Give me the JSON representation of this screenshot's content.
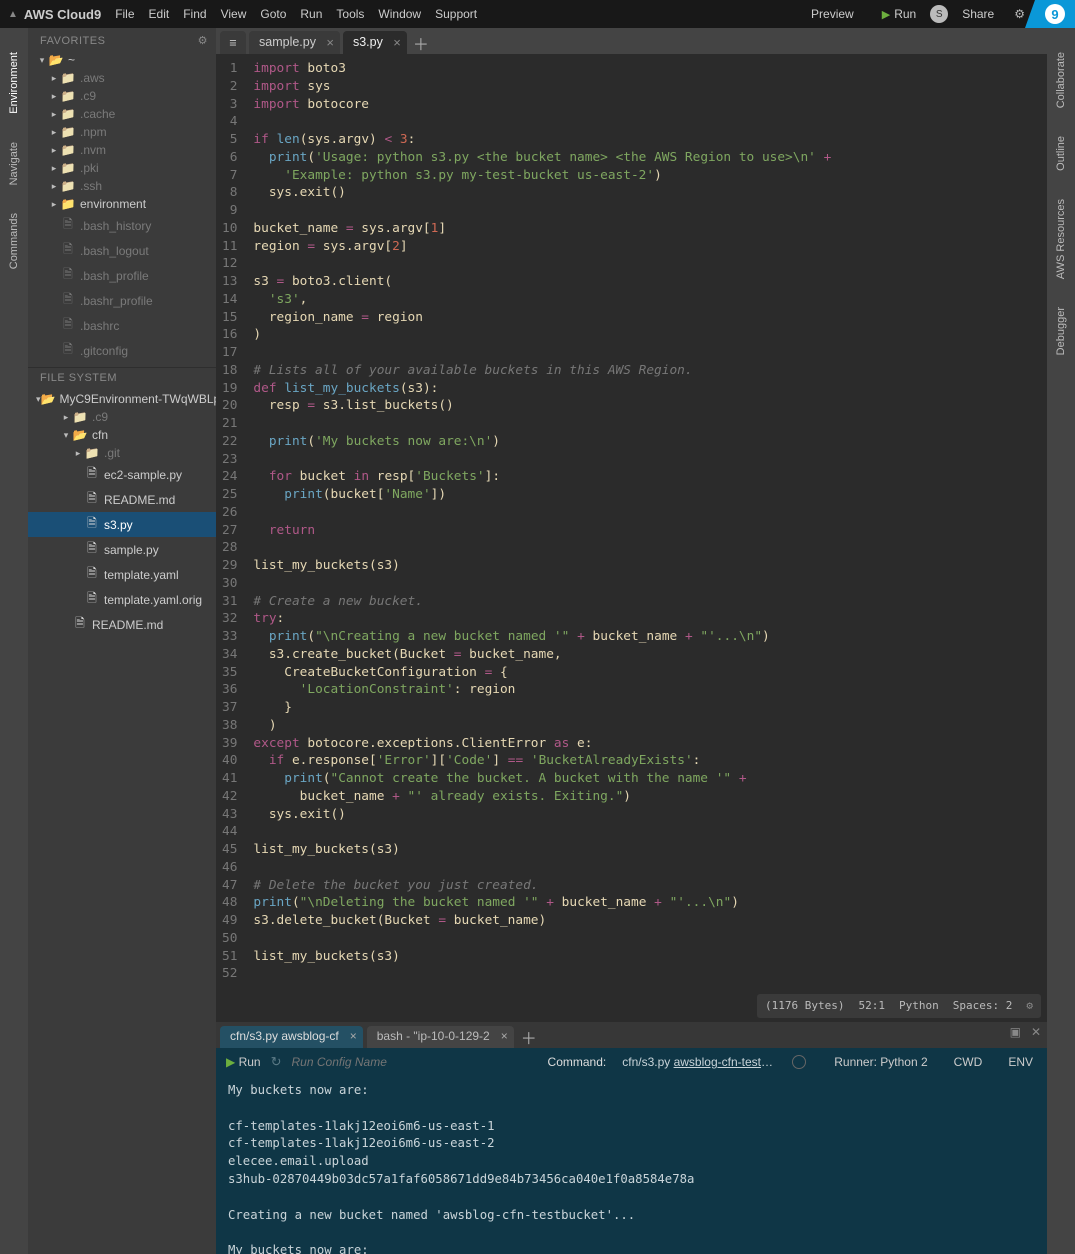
{
  "menubar": {
    "brand": "AWS Cloud9",
    "items": [
      "File",
      "Edit",
      "Find",
      "View",
      "Goto",
      "Run",
      "Tools",
      "Window",
      "Support"
    ],
    "preview": "Preview",
    "run": "Run",
    "share": "Share",
    "avatar_initial": "S"
  },
  "left_rail": [
    "Environment",
    "Navigate",
    "Commands"
  ],
  "right_rail": [
    "Collaborate",
    "Outline",
    "AWS Resources",
    "Debugger"
  ],
  "sidebar": {
    "favorites_label": "FAVORITES",
    "filesystem_label": "FILE SYSTEM",
    "home_label": "~",
    "home_children": [
      {
        "name": ".aws",
        "type": "folder",
        "hidden": true
      },
      {
        "name": ".c9",
        "type": "folder-special",
        "hidden": true
      },
      {
        "name": ".cache",
        "type": "folder",
        "hidden": true
      },
      {
        "name": ".npm",
        "type": "folder",
        "hidden": true
      },
      {
        "name": ".nvm",
        "type": "folder",
        "hidden": true
      },
      {
        "name": ".pki",
        "type": "folder",
        "hidden": true
      },
      {
        "name": ".ssh",
        "type": "folder",
        "hidden": true
      },
      {
        "name": "environment",
        "type": "folder",
        "hidden": false
      },
      {
        "name": ".bash_history",
        "type": "file",
        "hidden": true
      },
      {
        "name": ".bash_logout",
        "type": "file",
        "hidden": true
      },
      {
        "name": ".bash_profile",
        "type": "file",
        "hidden": true
      },
      {
        "name": ".bashr_profile",
        "type": "file",
        "hidden": true
      },
      {
        "name": ".bashrc",
        "type": "file",
        "hidden": true
      },
      {
        "name": ".gitconfig",
        "type": "file",
        "hidden": true
      }
    ],
    "env_root": "MyC9Environment-TWqWBLp",
    "env_children": [
      {
        "name": ".c9",
        "type": "folder",
        "hidden": true,
        "depth": 1
      },
      {
        "name": "cfn",
        "type": "folder",
        "hidden": false,
        "open": true,
        "depth": 1
      },
      {
        "name": ".git",
        "type": "folder-special",
        "hidden": true,
        "depth": 2
      },
      {
        "name": "ec2-sample.py",
        "type": "file",
        "depth": 2
      },
      {
        "name": "README.md",
        "type": "file",
        "depth": 2
      },
      {
        "name": "s3.py",
        "type": "file",
        "depth": 2,
        "selected": true
      },
      {
        "name": "sample.py",
        "type": "file",
        "depth": 2
      },
      {
        "name": "template.yaml",
        "type": "file",
        "depth": 2
      },
      {
        "name": "template.yaml.orig",
        "type": "file",
        "depth": 2
      },
      {
        "name": "README.md",
        "type": "file",
        "depth": 1
      }
    ]
  },
  "tabs": [
    {
      "label": "sample.py",
      "active": false
    },
    {
      "label": "s3.py",
      "active": true
    }
  ],
  "editor_status": {
    "bytes": "(1176 Bytes)",
    "pos": "52:1",
    "lang": "Python",
    "spaces": "Spaces: 2"
  },
  "code_lines": [
    "<span class='kw'>import</span> <span class='id'>boto3</span>",
    "<span class='kw'>import</span> <span class='id'>sys</span>",
    "<span class='kw'>import</span> <span class='id'>botocore</span>",
    "",
    "<span class='kw'>if</span> <span class='fn'>len</span>(sys.argv) <span class='op'>&lt;</span> <span class='num'>3</span>:",
    "  <span class='fn'>print</span>(<span class='str'>'Usage: python s3.py &lt;the bucket name&gt; &lt;the AWS Region to use&gt;\\n'</span> <span class='op'>+</span>",
    "    <span class='str'>'Example: python s3.py my-test-bucket us-east-2'</span>)",
    "  sys.exit()",
    "",
    "bucket_name <span class='op'>=</span> sys.argv[<span class='num'>1</span>]",
    "region <span class='op'>=</span> sys.argv[<span class='num'>2</span>]",
    "",
    "s3 <span class='op'>=</span> boto3.client(",
    "  <span class='str'>'s3'</span>,",
    "  region_name <span class='op'>=</span> region",
    ")",
    "",
    "<span class='com'># Lists all of your available buckets in this AWS Region.</span>",
    "<span class='kw'>def</span> <span class='fn'>list_my_buckets</span>(s3):",
    "  resp <span class='op'>=</span> s3.list_buckets()",
    "",
    "  <span class='fn'>print</span>(<span class='str'>'My buckets now are:\\n'</span>)",
    "",
    "  <span class='kw'>for</span> bucket <span class='kw'>in</span> resp[<span class='str'>'Buckets'</span>]:",
    "    <span class='fn'>print</span>(bucket[<span class='str'>'Name'</span>])",
    "",
    "  <span class='kw'>return</span>",
    "",
    "list_my_buckets(s3)",
    "",
    "<span class='com'># Create a new bucket.</span>",
    "<span class='kw'>try</span>:",
    "  <span class='fn'>print</span>(<span class='str'>\"\\nCreating a new bucket named '\"</span> <span class='op'>+</span> bucket_name <span class='op'>+</span> <span class='str'>\"'...\\n\"</span>)",
    "  s3.create_bucket(Bucket <span class='op'>=</span> bucket_name,",
    "    CreateBucketConfiguration <span class='op'>=</span> {",
    "      <span class='str'>'LocationConstraint'</span>: region",
    "    }",
    "  )",
    "<span class='kw'>except</span> botocore.exceptions.ClientError <span class='kw'>as</span> e:",
    "  <span class='kw'>if</span> e.response[<span class='str'>'Error'</span>][<span class='str'>'Code'</span>] <span class='op'>==</span> <span class='str'>'BucketAlreadyExists'</span>:",
    "    <span class='fn'>print</span>(<span class='str'>\"Cannot create the bucket. A bucket with the name '\"</span> <span class='op'>+</span>",
    "      bucket_name <span class='op'>+</span> <span class='str'>\"' already exists. Exiting.\"</span>)",
    "  sys.exit()",
    "",
    "list_my_buckets(s3)",
    "",
    "<span class='com'># Delete the bucket you just created.</span>",
    "<span class='fn'>print</span>(<span class='str'>\"\\nDeleting the bucket named '\"</span> <span class='op'>+</span> bucket_name <span class='op'>+</span> <span class='str'>\"'...\\n\"</span>)",
    "s3.delete_bucket(Bucket <span class='op'>=</span> bucket_name)",
    "",
    "list_my_buckets(s3)",
    ""
  ],
  "panel_tabs": [
    {
      "label": "cfn/s3.py awsblog-cf",
      "active": true
    },
    {
      "label": "bash - \"ip-10-0-129-2",
      "active": false
    }
  ],
  "runbar": {
    "run_label": "Run",
    "config_placeholder": "Run Config Name",
    "command_label": "Command:",
    "command_value_plain": "cfn/s3.py ",
    "command_value_rest": "awsblog-cfn-testbuck",
    "runner_label": "Runner: Python 2",
    "cwd_label": "CWD",
    "env_label": "ENV"
  },
  "terminal_lines": [
    "My buckets now are:",
    "",
    "cf-templates-1lakj12eoi6m6-us-east-1",
    "cf-templates-1lakj12eoi6m6-us-east-2",
    "elecee.email.upload",
    "s3hub-02870449b03dc57a1faf6058671dd9e84b73456ca040e1f0a8584e78a",
    "",
    "Creating a new bucket named 'awsblog-cfn-testbucket'...",
    "",
    "My buckets now are:"
  ]
}
